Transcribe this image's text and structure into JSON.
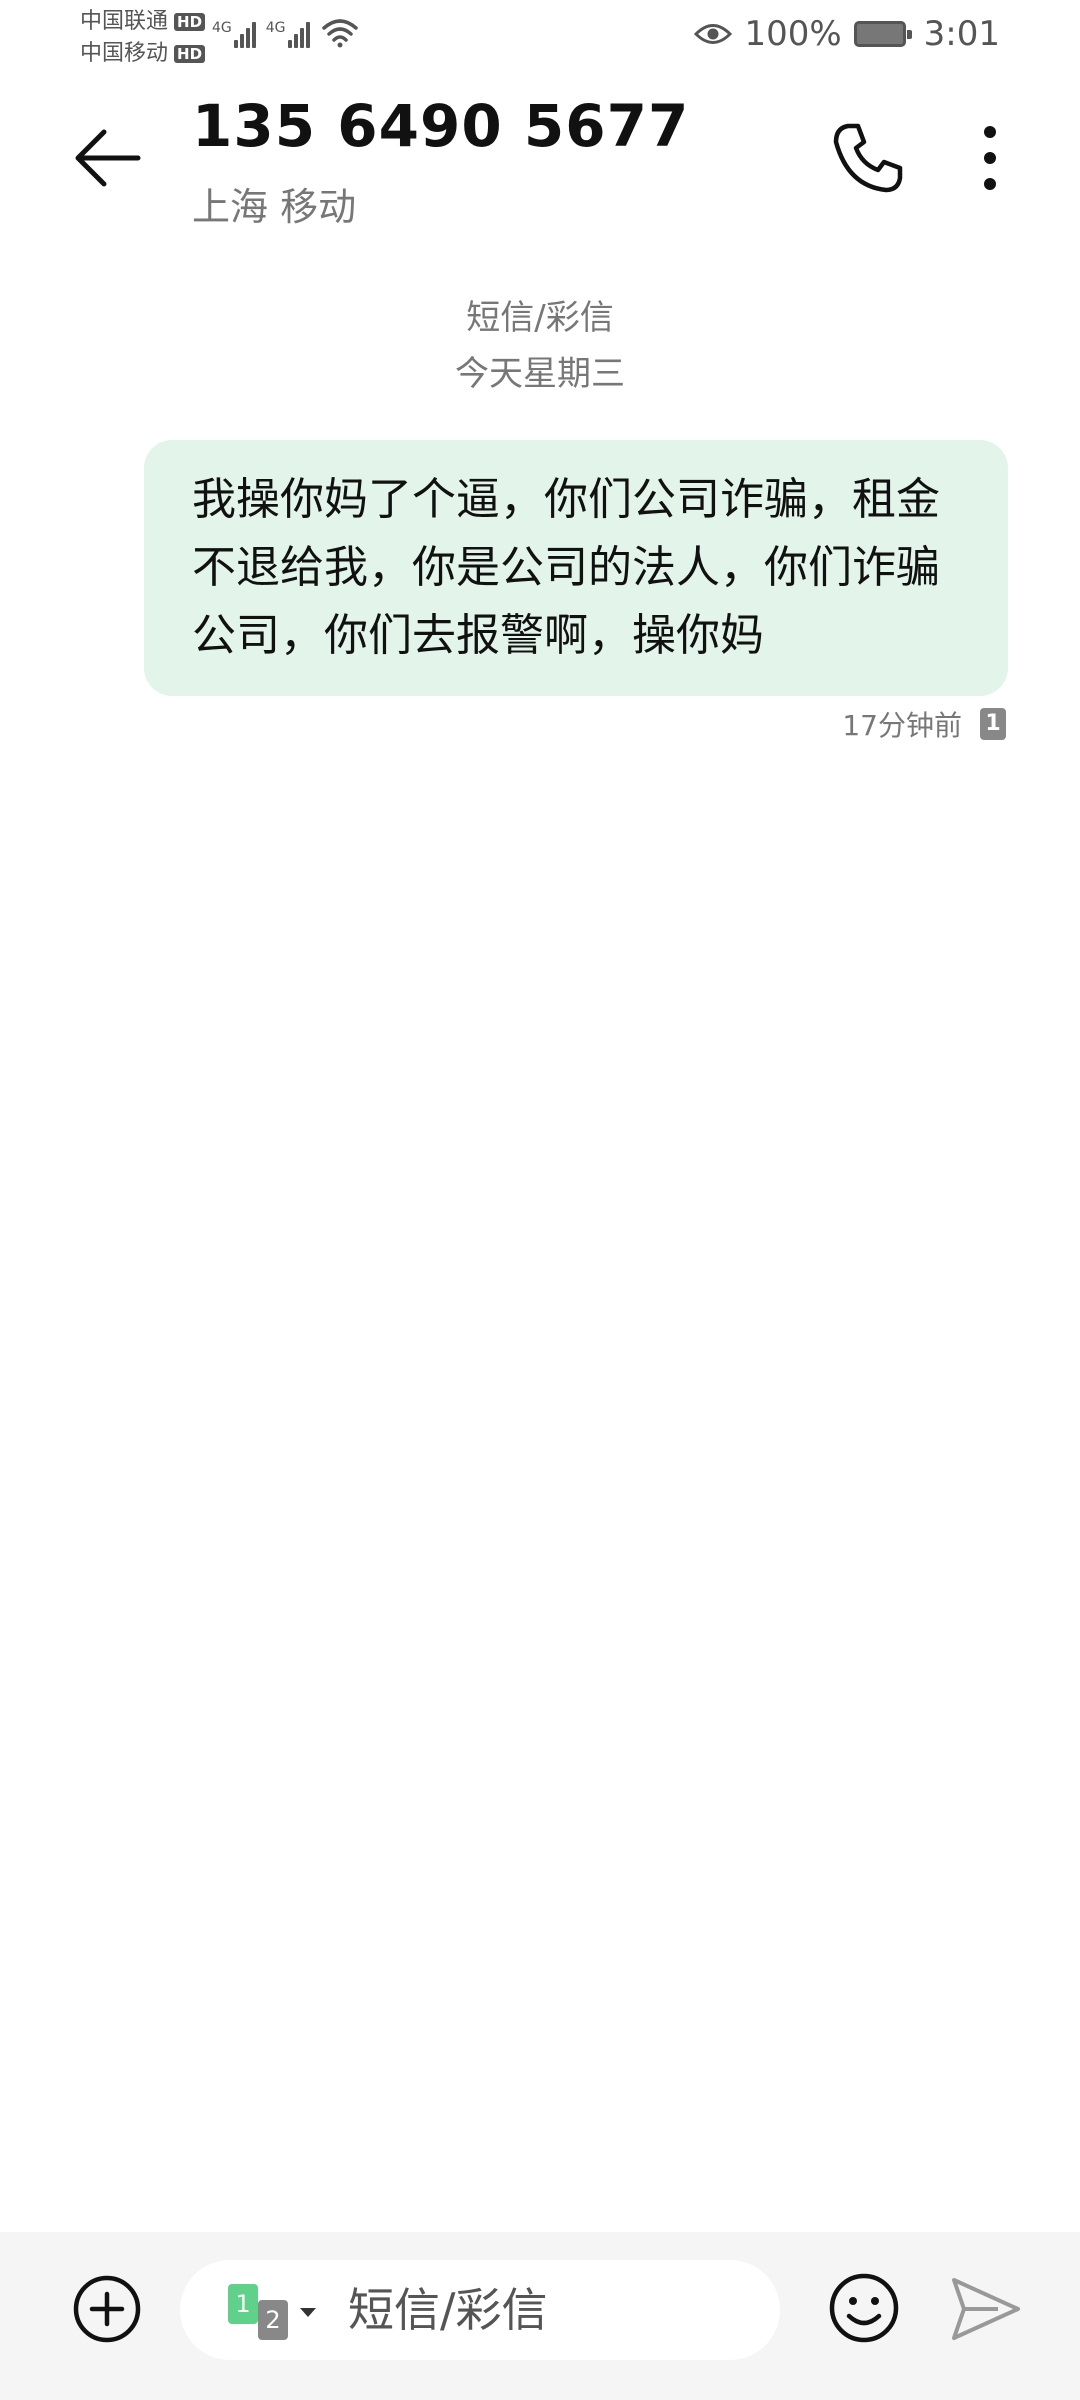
{
  "status_bar": {
    "carrier_1": "中国联通",
    "carrier_2": "中国移动",
    "hd_label": "HD",
    "network_type_1": "4G",
    "network_type_2": "4G",
    "battery_percent": "100%",
    "time": "3:01"
  },
  "header": {
    "contact_number": "135 6490 5677",
    "contact_location": "上海 移动"
  },
  "conversation": {
    "message_type": "短信/彩信",
    "date": "今天星期三",
    "messages": [
      {
        "direction": "outgoing",
        "text": "我操你妈了个逼，你们公司诈骗，租金不退给我，你是公司的法人，你们诈骗公司，你们去报警啊，操你妈",
        "time": "17分钟前",
        "sim": "1"
      }
    ]
  },
  "input_bar": {
    "placeholder": "短信/彩信",
    "sim_primary": "1",
    "sim_secondary": "2"
  },
  "colors": {
    "outgoing_bubble": "#e3f5eb",
    "sim1_accent": "#5fd18a"
  }
}
